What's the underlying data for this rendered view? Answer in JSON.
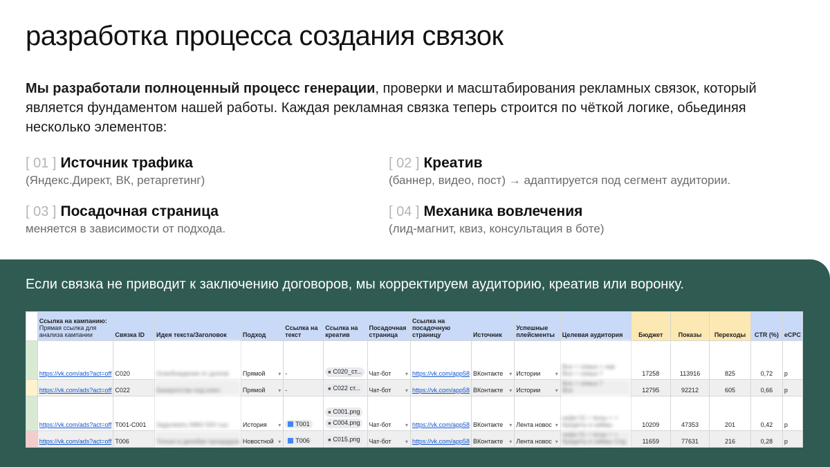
{
  "title": "разработка процесса создания связок",
  "intro": {
    "bold": "Мы разработали полноценный процесс генерации",
    "rest": ", проверки и масштабирования рекламных связок, который является фундаментом нашей работы. Каждая рекламная связка теперь строится по чёткой логике, обьединяя несколько элементов:"
  },
  "features": [
    {
      "num": "[ 01 ]",
      "title": "Источник трафика",
      "desc": "(Яндекс.Директ, ВК, ретаргетинг)"
    },
    {
      "num": "[ 02 ]",
      "title": "Креатив",
      "desc": "(баннер, видео, пост) → адаптируется под сегмент аудитории."
    },
    {
      "num": "[ 03 ]",
      "title": "Посадочная страница",
      "desc": "меняется в зависимости от подхода."
    },
    {
      "num": "[ 04 ]",
      "title": "Механика вовлечения",
      "desc": "(лид-магнит, квиз, консультация в боте)"
    }
  ],
  "note": "Если связка не приводит к заключению договоров, мы корректируем аудиторию, креатив или воронку.",
  "sheet": {
    "headers": {
      "campaign_title": "Ссылка на кампанию:",
      "campaign_sub": "Прямая ссылка для анализа кампании",
      "bundle_id": "Связка ID",
      "idea": "Идея текста/Заголовок",
      "approach": "Подход",
      "text_link": "Ссылка на текст",
      "creative_link": "Ссылка на креатив",
      "landing": "Посадочная страница",
      "landing_link": "Ссылка на посадочную страницу",
      "source": "Источник",
      "placements": "Успешные плейсменты",
      "audience": "Целевая аудитория",
      "budget": "Бюджет",
      "impressions": "Показы",
      "clicks": "Переходы",
      "ctr": "CTR (%)",
      "ecpc": "eCPC"
    },
    "rows": [
      {
        "color": "#d9ead3",
        "link": "https://vk.com/ads?act=off",
        "id": "C020",
        "idea": "Освобождение от долгов",
        "approach": "Прямой",
        "text": "-",
        "creative": [
          "C020_ст..."
        ],
        "creative_icon": "file",
        "landing": "Чат-бот",
        "landing_link": "https://vk.com/app58",
        "source": "ВКонтакте",
        "placements": "Истории",
        "audience": [
          "Все + семьи + нав",
          "Все + семьи 7"
        ],
        "budget": "17258",
        "impressions": "113916",
        "clicks": "825",
        "ctr": "0,72",
        "tail": "р"
      },
      {
        "color": "#fff2cc",
        "link": "https://vk.com/ads?act=off",
        "id": "C022",
        "idea": "Банкротство под ключ",
        "approach": "Прямой",
        "text": "-",
        "creative": [
          "C022 ст..."
        ],
        "creative_icon": "file",
        "landing": "Чат-бот",
        "landing_link": "https://vk.com/app58",
        "source": "ВКонтакте",
        "placements": "Истории",
        "audience": [
          "Все + семьи 7",
          "Все"
        ],
        "budget": "12795",
        "impressions": "92212",
        "clicks": "605",
        "ctr": "0,66",
        "tail": "р"
      },
      {
        "color": "#d9ead3",
        "link": "https://vk.com/ads?act=off",
        "id": "T001-C001",
        "idea": "Задолжать МФО 500 тыс",
        "approach": "История",
        "text": "T001",
        "creative": [
          "C001.png",
          "C004.png"
        ],
        "creative_icon": "file",
        "landing": "Чат-бот",
        "landing_link": "https://vk.com/app58",
        "source": "ВКонтакте",
        "placements": "Лента новос",
        "audience": [
          "кафе 01 + ясны + +",
          "Кредиты и займы"
        ],
        "budget": "10209",
        "impressions": "47353",
        "clicks": "201",
        "ctr": "0,42",
        "tail": "р"
      },
      {
        "color": "#f4cccc",
        "link": "https://vk.com/ads?act=off",
        "id": "T006",
        "idea": "Только в декабре процедура",
        "approach": "Новостной",
        "text": "T006",
        "creative": [
          "C015.png"
        ],
        "creative_icon": "file",
        "landing": "Чат-бот",
        "landing_link": "https://vk.com/app58",
        "source": "ВКонтакте",
        "placements": "Лента новос",
        "audience": [
          "кафе 01 + ясны + +",
          "Кредиты и займы Спд"
        ],
        "budget": "11659",
        "impressions": "77631",
        "clicks": "216",
        "ctr": "0,28",
        "tail": "р"
      }
    ]
  }
}
